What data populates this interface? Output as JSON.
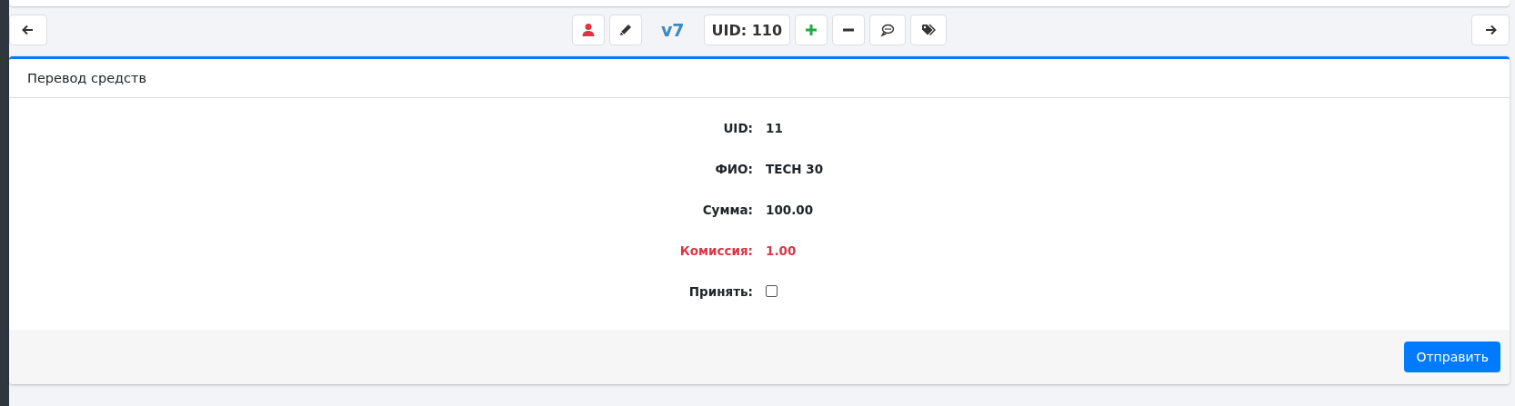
{
  "toolbar": {
    "version": "v7",
    "uid": "UID: 110",
    "buttons": [
      {
        "kind": "user"
      },
      {
        "kind": "edit"
      },
      {
        "kind": "version"
      },
      {
        "kind": "uid"
      },
      {
        "kind": "add"
      },
      {
        "kind": "remove"
      },
      {
        "kind": "comment"
      },
      {
        "kind": "tags"
      }
    ]
  },
  "card": {
    "title": "Перевод средств",
    "fields": [
      {
        "kind": "text",
        "label": "UID:",
        "value": "11",
        "alert": false
      },
      {
        "kind": "text",
        "label": "ФИО:",
        "value": "TECH 30",
        "alert": false
      },
      {
        "kind": "text",
        "label": "Сумма:",
        "value": "100.00",
        "alert": false
      },
      {
        "kind": "text",
        "label": "Комиссия:",
        "value": "1.00",
        "alert": true
      },
      {
        "kind": "checkbox",
        "label": "Принять:",
        "checked": false,
        "alert": false
      }
    ],
    "submit": "Отправить"
  }
}
